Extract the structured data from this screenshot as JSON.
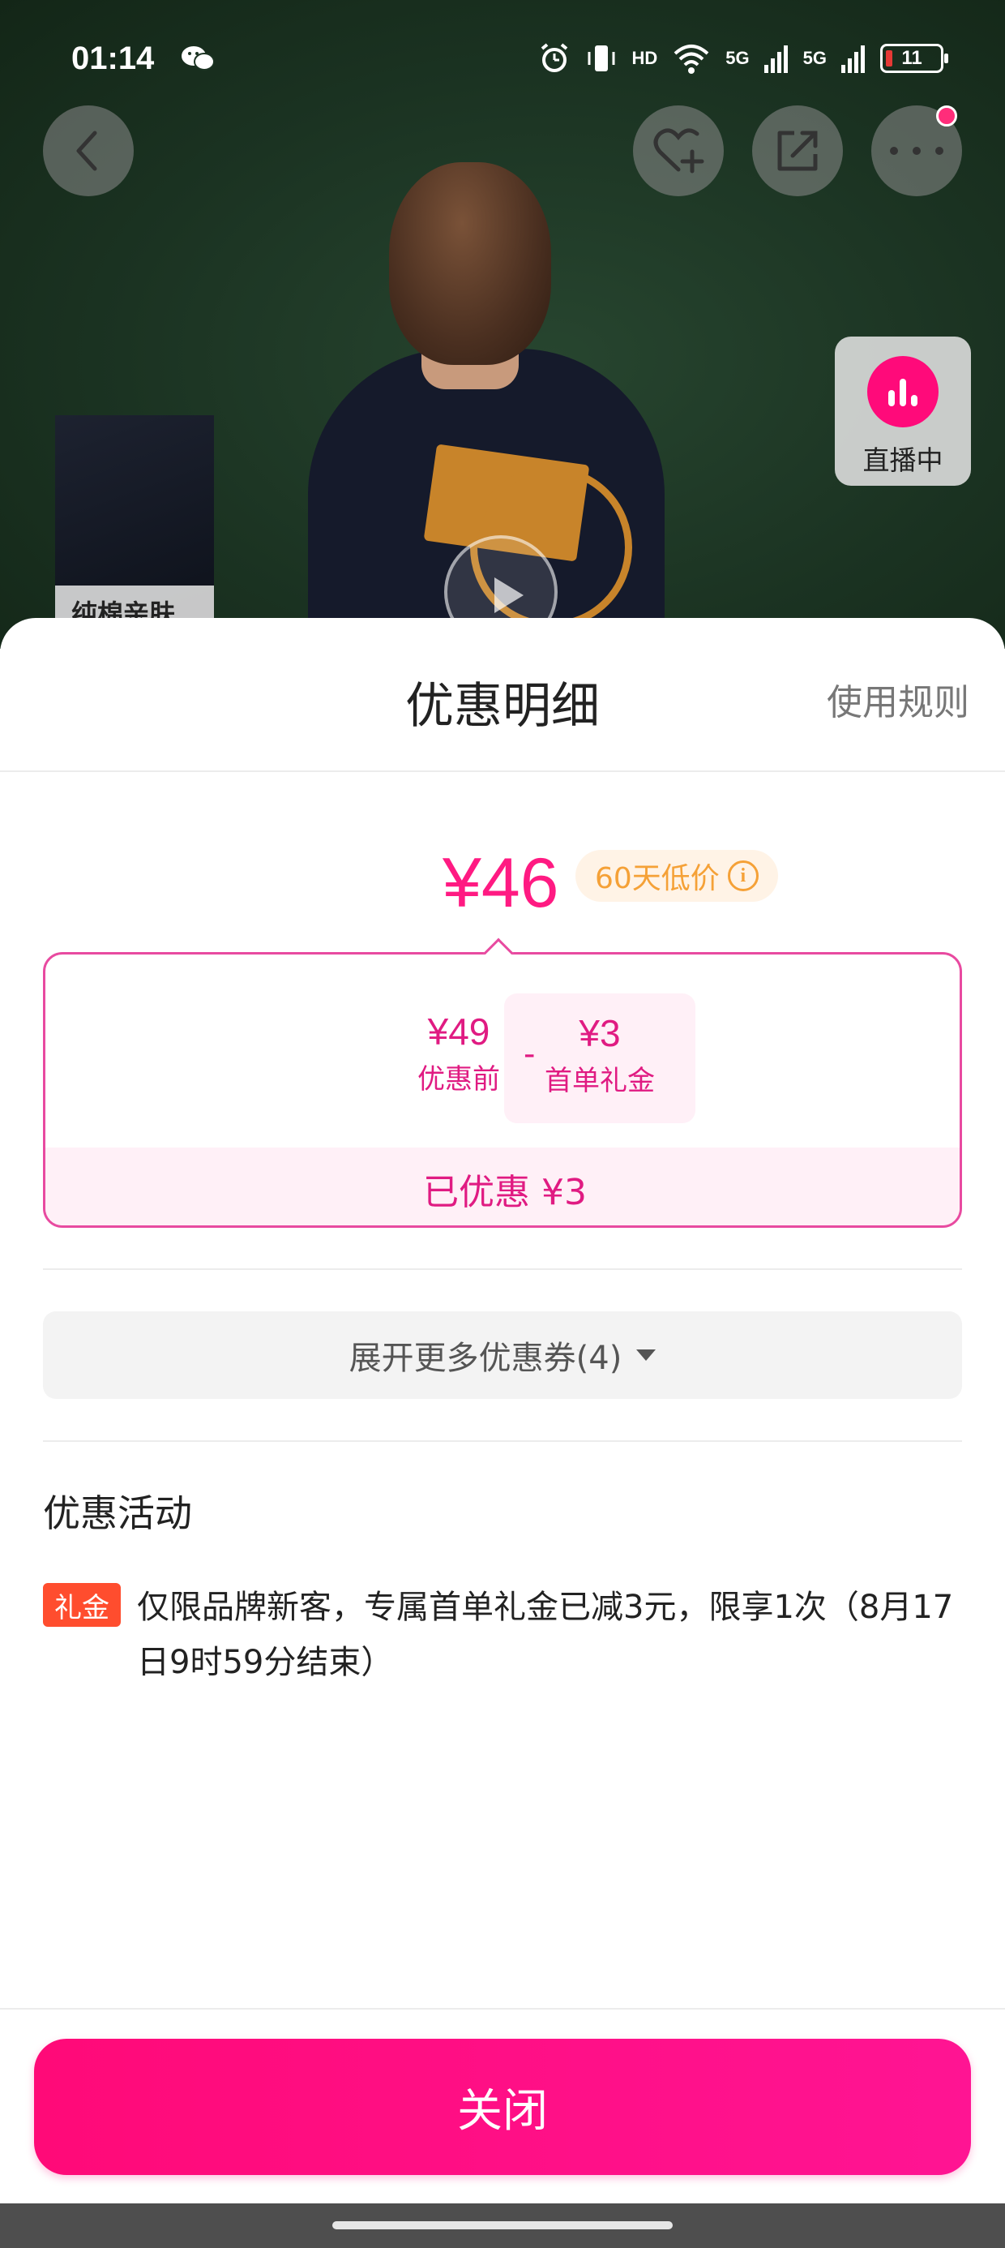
{
  "status_bar": {
    "time": "01:14",
    "battery_level": "11",
    "network_labels": [
      "HD",
      "5G",
      "5G"
    ]
  },
  "product_area": {
    "thumbnail_label": "纯棉亲肤",
    "live_badge_label": "直播中"
  },
  "sheet": {
    "title": "优惠明细",
    "rules_link": "使用规则",
    "final_price": "¥46",
    "price_tag": "60天低价",
    "calculation": {
      "original_amount": "¥49",
      "original_label": "优惠前",
      "operator": "-",
      "gift_amount": "¥3",
      "gift_label": "首单礼金",
      "saved_text": "已优惠 ¥3"
    },
    "expand_coupons": "展开更多优惠券(4)",
    "activities_title": "优惠活动",
    "activity": {
      "tag": "礼金",
      "text": "仅限品牌新客，专属首单礼金已减3元，限享1次（8月17日9时59分结束）"
    },
    "close_button": "关闭"
  },
  "colors": {
    "accent": "#ff1a82",
    "gift_tag": "#ff4d2e",
    "low_price_text": "#f5a137",
    "live": "#ff0a7a"
  },
  "icons": [
    "wechat-icon",
    "alarm-icon",
    "vibrate-icon",
    "wifi-icon",
    "back-icon",
    "favorite-add-icon",
    "share-icon",
    "more-icon",
    "live-bars-icon",
    "play-icon",
    "info-icon",
    "caret-down-icon"
  ]
}
